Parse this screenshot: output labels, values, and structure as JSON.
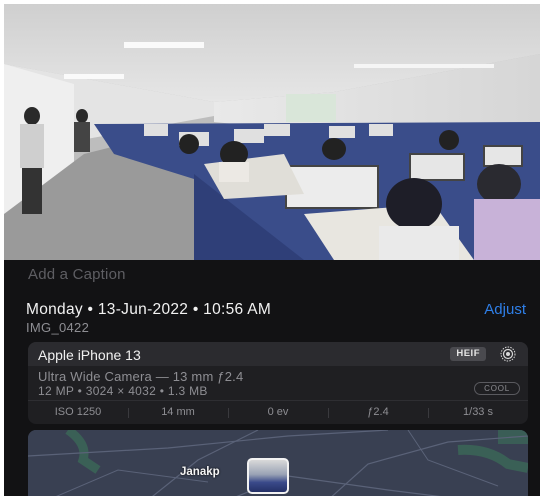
{
  "photo": {
    "description_icon": "photo-preview"
  },
  "caption": {
    "placeholder": "Add a Caption"
  },
  "header": {
    "datetime": "Monday • 13-Jun-2022 • 10:56 AM",
    "adjust_label": "Adjust",
    "filename": "IMG_0422"
  },
  "camera": {
    "device": "Apple iPhone 13",
    "format_badge": "HEIF",
    "live_icon": "live-photo-icon",
    "lens": "Ultra Wide Camera — 13 mm ƒ2.4",
    "specs": "12 MP  •  3024 × 4032  •  1.3 MB",
    "style_badge": "COOL",
    "exif": [
      "ISO 1250",
      "14 mm",
      "0 ev",
      "ƒ2.4",
      "1/33 s"
    ]
  },
  "map": {
    "place_label": "Janakp",
    "pin_icon": "photo-location-pin"
  },
  "colors": {
    "accent": "#2f7fe8",
    "background": "#121214",
    "card": "#1f1f22"
  }
}
